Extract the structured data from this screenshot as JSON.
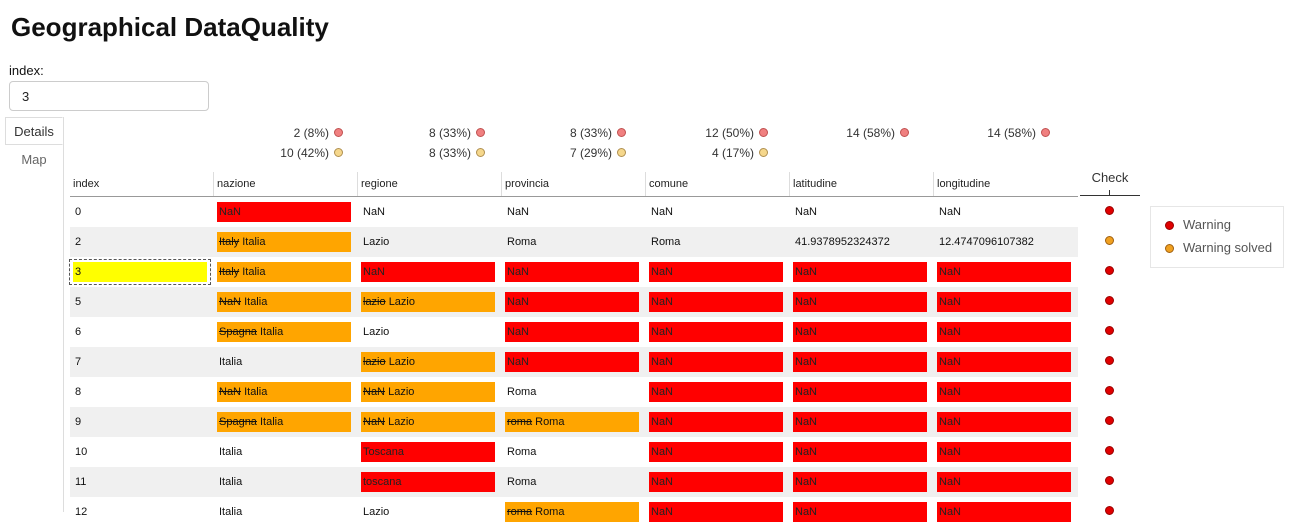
{
  "title": "Geographical DataQuality",
  "index_field": {
    "label": "index:",
    "value": "3"
  },
  "tabs": [
    {
      "label": "Details",
      "active": true
    },
    {
      "label": "Map",
      "active": false
    }
  ],
  "colors": {
    "error": "#ff0000",
    "corrected": "#ffa500",
    "selected": "#ffff00",
    "warning": "#e00000",
    "warning_solved": "#f0a020"
  },
  "summary": [
    {
      "column": "nazione",
      "warning": "2 (8%)",
      "solved": "10 (42%)"
    },
    {
      "column": "regione",
      "warning": "8 (33%)",
      "solved": "8 (33%)"
    },
    {
      "column": "provincia",
      "warning": "8 (33%)",
      "solved": "7 (29%)"
    },
    {
      "column": "comune",
      "warning": "12 (50%)",
      "solved": "4 (17%)"
    },
    {
      "column": "latitudine",
      "warning": "14 (58%)",
      "solved": null
    },
    {
      "column": "longitudine",
      "warning": "14 (58%)",
      "solved": null
    }
  ],
  "columns": [
    "index",
    "nazione",
    "regione",
    "provincia",
    "comune",
    "latitudine",
    "longitudine"
  ],
  "check_header": "Check",
  "legend": [
    {
      "label": "Warning",
      "color": "red"
    },
    {
      "label": "Warning solved",
      "color": "orange"
    }
  ],
  "rows": [
    {
      "index": "0",
      "check": "warning",
      "cells": [
        {
          "new": "NaN",
          "style": "red"
        },
        {
          "new": "NaN"
        },
        {
          "new": "NaN"
        },
        {
          "new": "NaN"
        },
        {
          "new": "NaN"
        },
        {
          "new": "NaN"
        }
      ]
    },
    {
      "index": "2",
      "check": "solved",
      "cells": [
        {
          "old": "Italy",
          "new": "Italia",
          "style": "org"
        },
        {
          "new": "Lazio"
        },
        {
          "new": "Roma"
        },
        {
          "new": "Roma"
        },
        {
          "new": "41.9378952324372"
        },
        {
          "new": "12.4747096107382"
        }
      ]
    },
    {
      "index": "3",
      "check": "warning",
      "selected": true,
      "cells": [
        {
          "old": "Italy",
          "new": "Italia",
          "style": "org"
        },
        {
          "new": "NaN",
          "style": "red"
        },
        {
          "new": "NaN",
          "style": "red"
        },
        {
          "new": "NaN",
          "style": "red"
        },
        {
          "new": "NaN",
          "style": "red"
        },
        {
          "new": "NaN",
          "style": "red"
        }
      ]
    },
    {
      "index": "5",
      "check": "warning",
      "cells": [
        {
          "old": "NaN",
          "new": "Italia",
          "style": "org"
        },
        {
          "old": "lazio",
          "new": "Lazio",
          "style": "org"
        },
        {
          "new": "NaN",
          "style": "red"
        },
        {
          "new": "NaN",
          "style": "red"
        },
        {
          "new": "NaN",
          "style": "red"
        },
        {
          "new": "NaN",
          "style": "red"
        }
      ]
    },
    {
      "index": "6",
      "check": "warning",
      "cells": [
        {
          "old": "Spagna",
          "new": "Italia",
          "style": "org"
        },
        {
          "new": "Lazio"
        },
        {
          "new": "NaN",
          "style": "red"
        },
        {
          "new": "NaN",
          "style": "red"
        },
        {
          "new": "NaN",
          "style": "red"
        },
        {
          "new": "NaN",
          "style": "red"
        }
      ]
    },
    {
      "index": "7",
      "check": "warning",
      "cells": [
        {
          "new": "Italia"
        },
        {
          "old": "lazio",
          "new": "Lazio",
          "style": "org"
        },
        {
          "new": "NaN",
          "style": "red"
        },
        {
          "new": "NaN",
          "style": "red"
        },
        {
          "new": "NaN",
          "style": "red"
        },
        {
          "new": "NaN",
          "style": "red"
        }
      ]
    },
    {
      "index": "8",
      "check": "warning",
      "cells": [
        {
          "old": "NaN",
          "new": "Italia",
          "style": "org"
        },
        {
          "old": "NaN",
          "new": "Lazio",
          "style": "org"
        },
        {
          "new": "Roma"
        },
        {
          "new": "NaN",
          "style": "red"
        },
        {
          "new": "NaN",
          "style": "red"
        },
        {
          "new": "NaN",
          "style": "red"
        }
      ]
    },
    {
      "index": "9",
      "check": "warning",
      "cells": [
        {
          "old": "Spagna",
          "new": "Italia",
          "style": "org"
        },
        {
          "old": "NaN",
          "new": "Lazio",
          "style": "org"
        },
        {
          "old": "roma",
          "new": "Roma",
          "style": "org"
        },
        {
          "new": "NaN",
          "style": "red"
        },
        {
          "new": "NaN",
          "style": "red"
        },
        {
          "new": "NaN",
          "style": "red"
        }
      ]
    },
    {
      "index": "10",
      "check": "warning",
      "cells": [
        {
          "new": "Italia"
        },
        {
          "new": "Toscana",
          "style": "red"
        },
        {
          "new": "Roma"
        },
        {
          "new": "NaN",
          "style": "red"
        },
        {
          "new": "NaN",
          "style": "red"
        },
        {
          "new": "NaN",
          "style": "red"
        }
      ]
    },
    {
      "index": "11",
      "check": "warning",
      "cells": [
        {
          "new": "Italia"
        },
        {
          "new": "toscana",
          "style": "red"
        },
        {
          "new": "Roma"
        },
        {
          "new": "NaN",
          "style": "red"
        },
        {
          "new": "NaN",
          "style": "red"
        },
        {
          "new": "NaN",
          "style": "red"
        }
      ]
    },
    {
      "index": "12",
      "check": "warning",
      "cells": [
        {
          "new": "Italia"
        },
        {
          "new": "Lazio"
        },
        {
          "old": "roma",
          "new": "Roma",
          "style": "org"
        },
        {
          "new": "NaN",
          "style": "red"
        },
        {
          "new": "NaN",
          "style": "red"
        },
        {
          "new": "NaN",
          "style": "red"
        }
      ]
    }
  ]
}
